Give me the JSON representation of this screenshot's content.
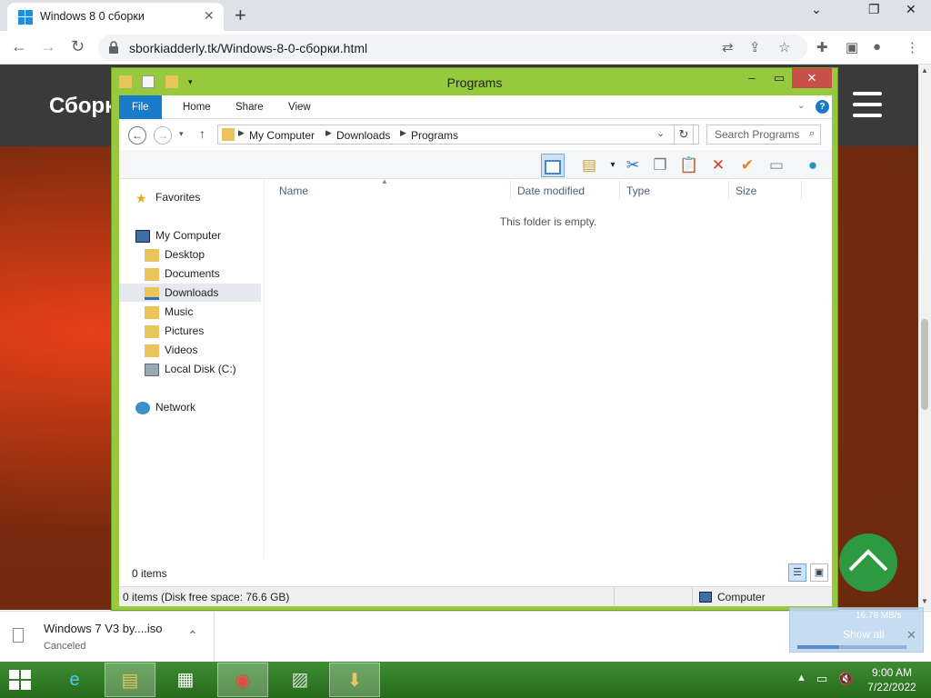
{
  "browser": {
    "tab_title": "Windows 8 0 сборки",
    "url": "sborkiadderly.tk/Windows-8-0-сборки.html",
    "new_tab": "+",
    "minimize": "⌄",
    "restore": "❐",
    "close": "✕"
  },
  "site": {
    "title": "Сборк"
  },
  "explorer": {
    "window_title": "Programs",
    "ribbon_tabs": [
      "File",
      "Home",
      "Share",
      "View"
    ],
    "breadcrumb": [
      "My Computer",
      "Downloads",
      "Programs"
    ],
    "search_placeholder": "Search Programs",
    "columns": [
      "Name",
      "Date modified",
      "Type",
      "Size"
    ],
    "empty_message": "This folder is empty.",
    "nav": {
      "favorites": "Favorites",
      "my_computer": "My Computer",
      "desktop": "Desktop",
      "documents": "Documents",
      "downloads": "Downloads",
      "music": "Music",
      "pictures": "Pictures",
      "videos": "Videos",
      "local_disk": "Local Disk (C:)",
      "network": "Network"
    },
    "item_count": "0 items",
    "status_text": "0 items (Disk free space: 76.6 GB)",
    "status_location": "Computer"
  },
  "downloads": {
    "file_name": "Windows 7 V3 by....iso",
    "file_status": "Canceled",
    "speed": "16.78 MB/s",
    "show_all": "Show all",
    "progress_fraction": 0.38
  },
  "taskbar": {
    "time": "9:00 AM",
    "date": "7/22/2022"
  },
  "colors": {
    "explorer_frame": "#96c93d",
    "file_tab": "#1979ca",
    "taskbar": "#3d8d32",
    "to_top_button": "#2e9a3f"
  }
}
